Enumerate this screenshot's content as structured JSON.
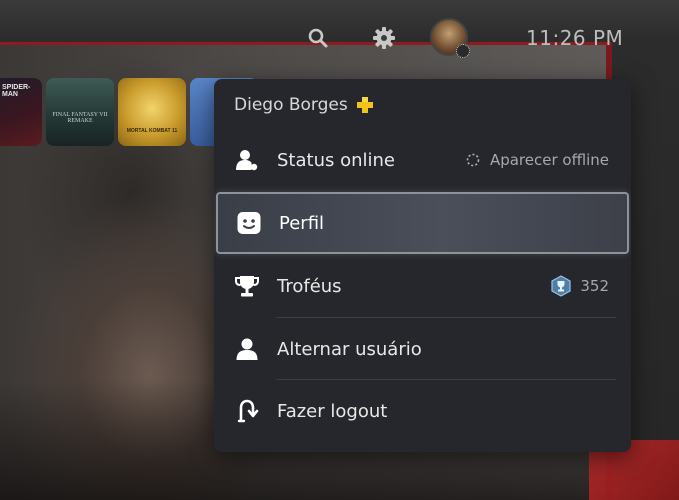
{
  "topbar": {
    "clock": "11:26 PM",
    "icons": [
      "search-icon",
      "gear-icon",
      "avatar"
    ]
  },
  "tiles": [
    {
      "label": "SPIDER-MAN"
    },
    {
      "label": "FINAL FANTASY VII REMAKE"
    },
    {
      "label": "MORTAL KOMBAT 11"
    },
    {
      "label": ""
    }
  ],
  "menu": {
    "username": "Diego Borges",
    "items": [
      {
        "label": "Status online",
        "icon": "user-status-icon",
        "right_text": "Aparecer offline",
        "right_icon": "offline-ring-icon"
      },
      {
        "label": "Perfil",
        "icon": "profile-face-icon",
        "selected": true
      },
      {
        "label": "Troféus",
        "icon": "trophy-icon",
        "right_text": "352",
        "right_icon": "trophy-level-badge-icon"
      },
      {
        "label": "Alternar usuário",
        "icon": "user-icon"
      },
      {
        "label": "Fazer logout",
        "icon": "logout-icon"
      }
    ]
  },
  "colors": {
    "plus_yellow": "#f2c41a",
    "menu_bg": "#25272c",
    "selected_border": "#8e929a",
    "accent_red": "#8a1c22",
    "trophy_badge": "#4f7ea8"
  }
}
